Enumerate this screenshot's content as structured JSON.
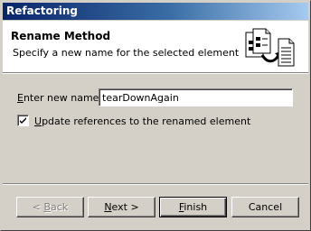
{
  "window": {
    "title": "Refactoring"
  },
  "header": {
    "title": "Rename Method",
    "subtitle": "Specify a new name for the selected element",
    "icon": "rename-refactoring-icon"
  },
  "form": {
    "new_name_label_accel": "E",
    "new_name_label_rest": "nter new name:",
    "new_name_value": "tearDownAgain",
    "update_refs_checked": true,
    "update_refs_label_accel": "U",
    "update_refs_label_rest": "pdate references to the renamed element"
  },
  "buttons": {
    "back_prefix": "< ",
    "back_accel": "B",
    "back_rest": "ack",
    "back_enabled": false,
    "next_accel": "N",
    "next_rest": "ext >",
    "finish_accel": "F",
    "finish_rest": "inish",
    "cancel_label": "Cancel"
  },
  "colors": {
    "title_gradient_start": "#0a246a",
    "title_gradient_end": "#a6caf0",
    "dialog_face": "#d4d0c8",
    "header_bg": "#ffffff"
  }
}
